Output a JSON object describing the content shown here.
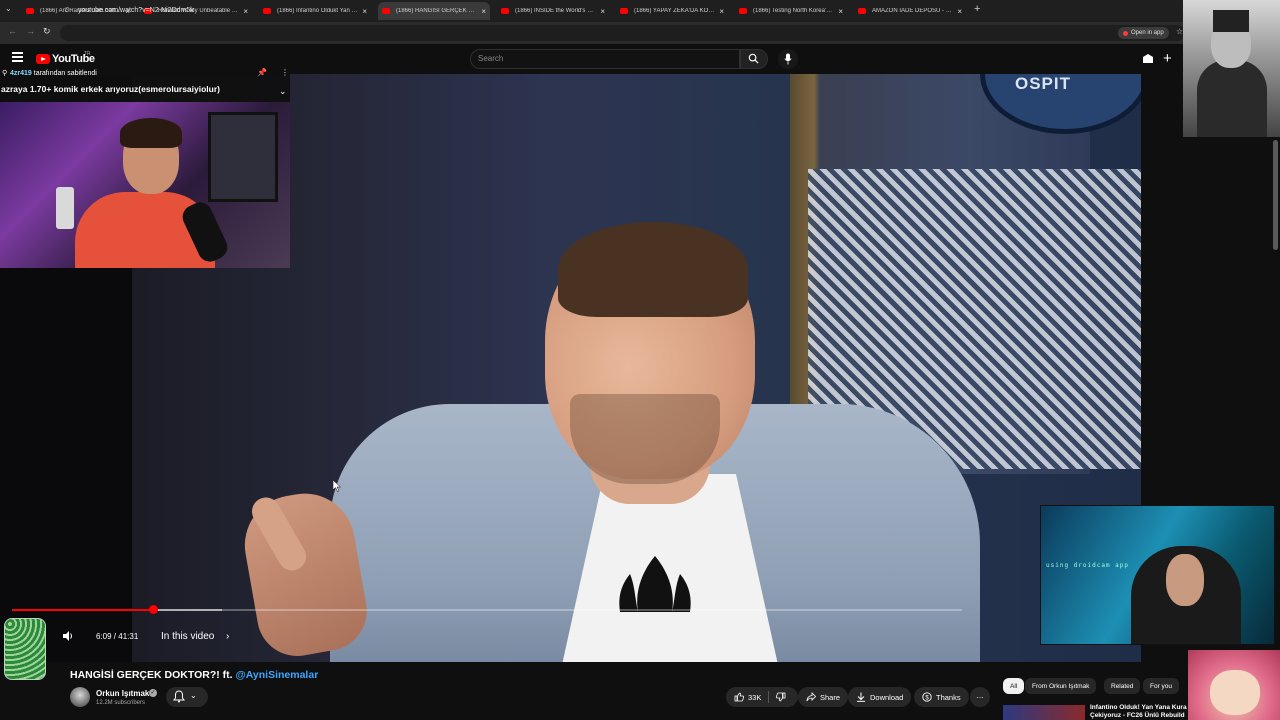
{
  "browser": {
    "tabs": [
      {
        "title": "(1866) Arc Raiders dam battleg..."
      },
      {
        "title": "Ronaldo vs My Unbeatable Goa..."
      },
      {
        "title": "(1866) Infantino Oldukt Yan Yan..."
      },
      {
        "title": "(1866) HANGİSİ GERÇEK DOKTO..."
      },
      {
        "title": "(1866) INSIDE the World's Most..."
      },
      {
        "title": "(1866) YAPAY ZEKA'DA KORKU..."
      },
      {
        "title": "(1866) Testing North Korea's ill..."
      },
      {
        "title": "AMAZON İADE DEPOSU - ÜRÜ..."
      }
    ],
    "active_tab_index": 3,
    "url": "youtube.com/watch?v=N2-Ni2Ddm5k",
    "open_in_app_label": "Open in app"
  },
  "youtube": {
    "logo_text": "YouTube",
    "region_code": "TR",
    "search_placeholder": "Search"
  },
  "pinned_chat": {
    "user": "4zr419",
    "suffix": "tarafından sabitlendi",
    "message": "azraya 1.70+ komik erkek arıyoruz(esmerolursaiyiolur)"
  },
  "player": {
    "current_time": "6:09",
    "duration": "41:31",
    "progress": 0.148,
    "buffered": 0.221,
    "chapter_label": "In this video"
  },
  "webcam_overlay_text": "using droidcam app",
  "video_sign_text": "OSPIT",
  "video": {
    "title": "HANGİSİ GERÇEK DOKTOR?! ft.",
    "title_mention": "@AyniSinemalar",
    "channel_name": "Orkun Işıtmak",
    "subscribers": "12.2M subscribers"
  },
  "actions": {
    "likes": "33K",
    "share": "Share",
    "download": "Download",
    "thanks": "Thanks"
  },
  "chips": [
    "All",
    "From Orkun Işıtmak",
    "Related",
    "For you"
  ],
  "recommendation": {
    "title": "Infantino Olduk! Yan Yana Kura Çekiyoruz - FC26 Ünlü Rebuild"
  },
  "colors": {
    "brand_red": "#ff0000",
    "link_blue": "#3ea6ff",
    "background": "#0f0f0f"
  }
}
